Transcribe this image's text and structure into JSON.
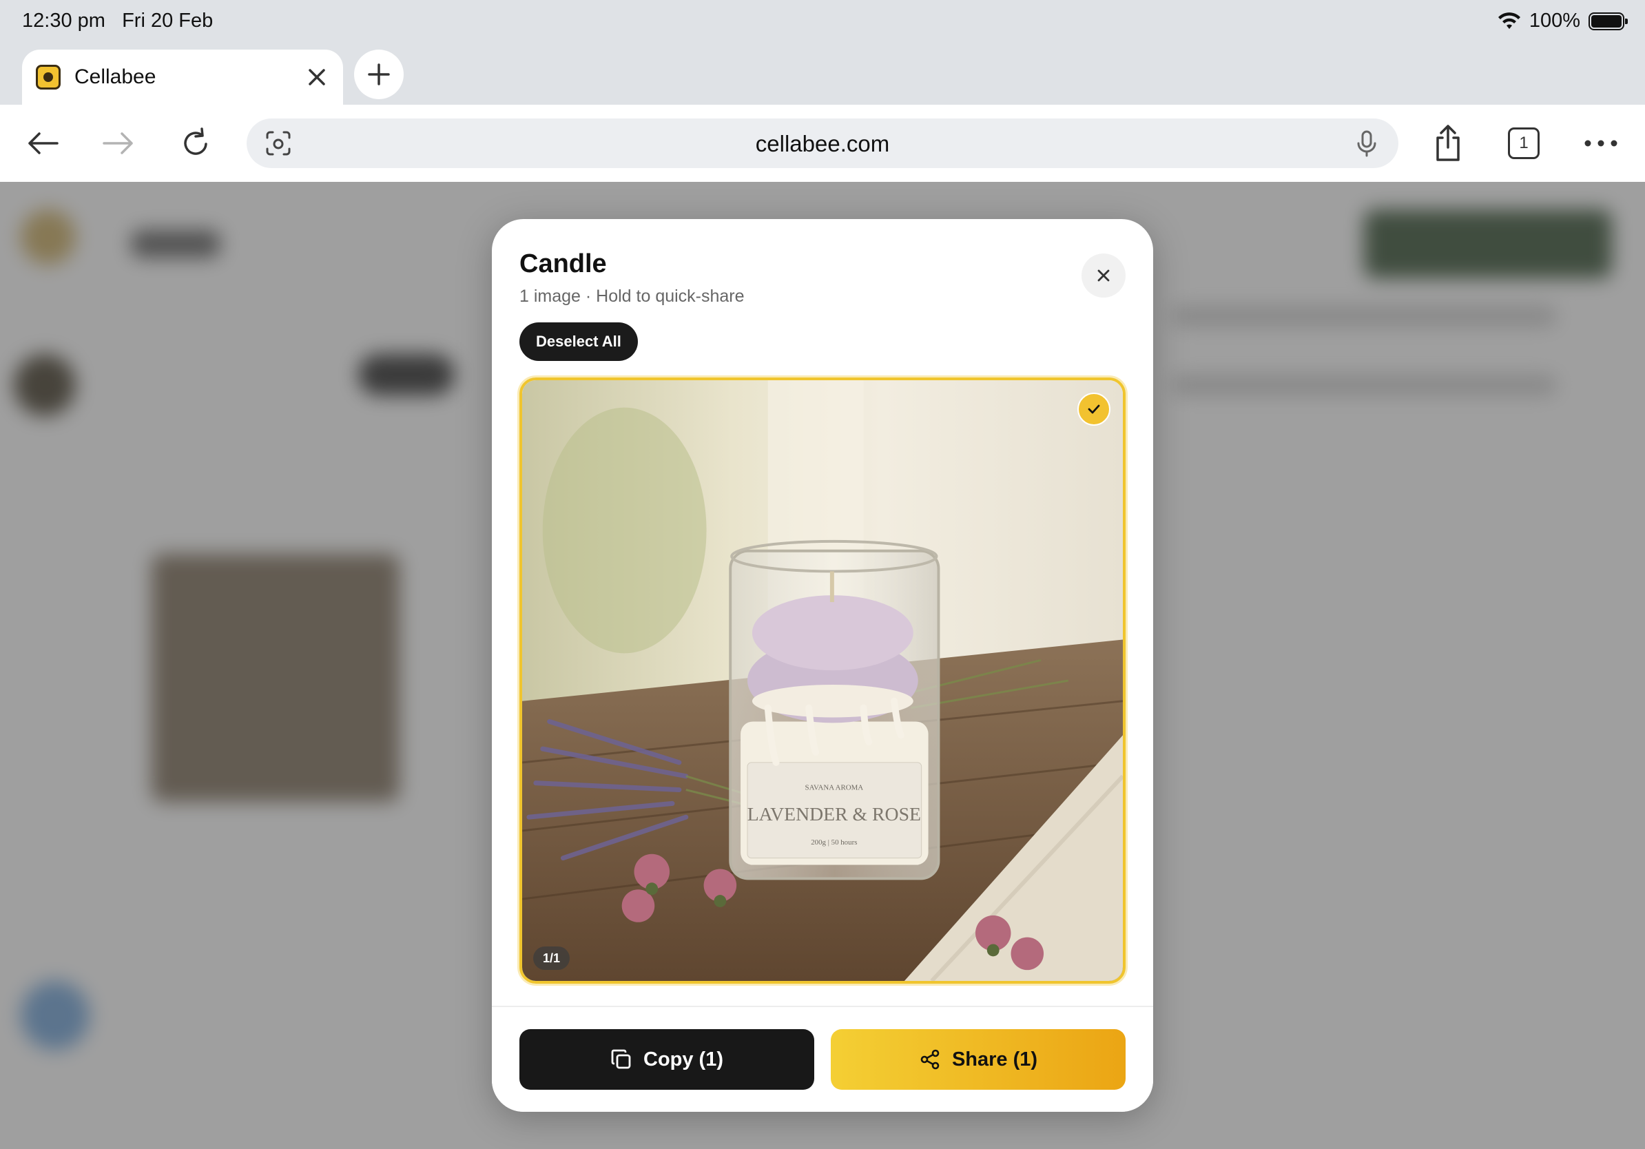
{
  "status_bar": {
    "time": "12:30 pm",
    "date": "Fri 20 Feb",
    "battery": "100%"
  },
  "browser": {
    "tab_title": "Cellabee",
    "url": "cellabee.com",
    "tab_count": "1"
  },
  "modal": {
    "title": "Candle",
    "subtitle": "1 image · Hold to quick-share",
    "deselect_label": "Deselect All",
    "image": {
      "counter": "1/1",
      "selected": true,
      "label_brand": "SAVANA AROMA",
      "label_name": "LAVENDER & ROSE",
      "label_detail": "200g | 50 hours"
    },
    "copy_label": "Copy (1)",
    "share_label": "Share (1)"
  },
  "colors": {
    "accent": "#f2c230",
    "dark_button": "#181818"
  }
}
